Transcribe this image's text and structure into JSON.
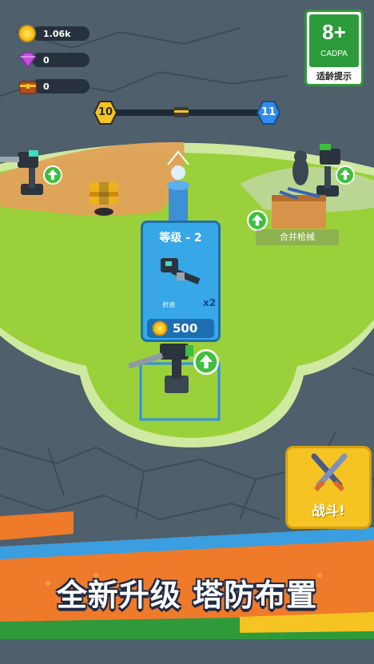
{
  "resources": {
    "coins": "1.06k",
    "gems": "0",
    "chests": "0"
  },
  "level": {
    "current": "10",
    "next": "11"
  },
  "age_rating": {
    "rating": "8+",
    "org": "CADPA",
    "note": "适龄提示"
  },
  "upgrade_card": {
    "title": "等级 - 2",
    "stat_label": "射速",
    "stat_multiplier": "x2",
    "price": "500"
  },
  "merge_station": {
    "label": "合并枪械"
  },
  "fight_button": {
    "label": "战斗!"
  },
  "banner": {
    "text": "全新升级 塔防布置"
  },
  "colors": {
    "arena_green": "#9ad13a",
    "dirt_orange": "#e2a25a",
    "card_blue": "#38a7e8",
    "fight_yellow": "#f5c422",
    "banner_orange": "#ef7a2a",
    "upgrade_arrow_green": "#3fbf3f"
  }
}
